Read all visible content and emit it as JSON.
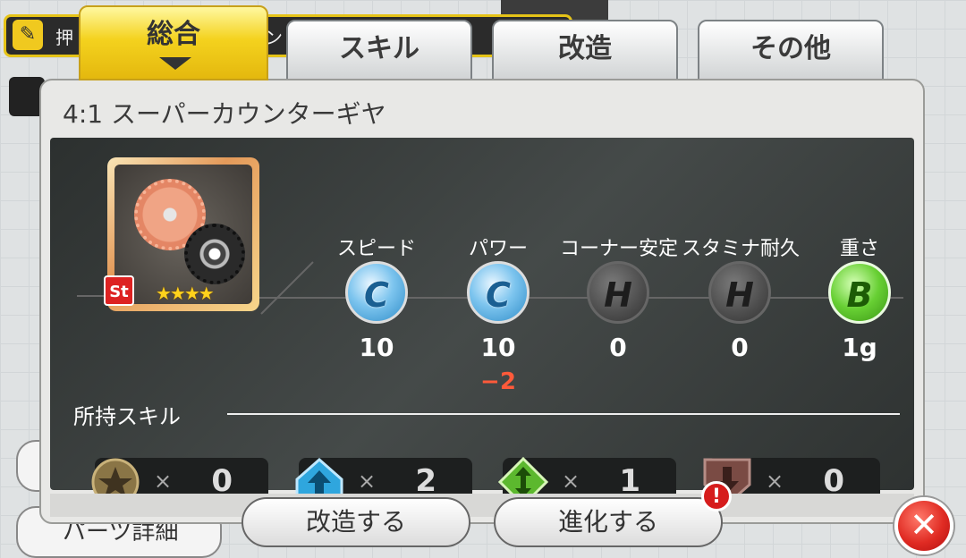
{
  "background": {
    "top_bar_label": "押",
    "top_bar_label_tail": "ン",
    "left_button_label": "パーツ詳細"
  },
  "tabs": [
    {
      "label": "総合",
      "active": true
    },
    {
      "label": "スキル",
      "active": false
    },
    {
      "label": "改造",
      "active": false
    },
    {
      "label": "その他",
      "active": false
    }
  ],
  "panel": {
    "title": "4:1 スーパーカウンターギヤ",
    "part": {
      "badge": "St",
      "stars": "★★★★",
      "star_count": 4
    },
    "stats": [
      {
        "label": "スピード",
        "grade": "C",
        "value": "10",
        "delta": ""
      },
      {
        "label": "パワー",
        "grade": "C",
        "value": "10",
        "delta": "−2"
      },
      {
        "label": "コーナー安定",
        "grade": "H",
        "value": "0",
        "delta": ""
      },
      {
        "label": "スタミナ耐久",
        "grade": "H",
        "value": "0",
        "delta": ""
      },
      {
        "label": "重さ",
        "grade": "B",
        "value": "1g",
        "delta": ""
      }
    ],
    "skills_heading": "所持スキル",
    "skills": [
      {
        "icon": "star-icon",
        "x": "×",
        "count": "0"
      },
      {
        "icon": "up-arrow-icon",
        "x": "×",
        "count": "2"
      },
      {
        "icon": "up-down-arrow-icon",
        "x": "×",
        "count": "1"
      },
      {
        "icon": "down-arrow-icon",
        "x": "×",
        "count": "0"
      }
    ]
  },
  "buttons": {
    "modify": "改造する",
    "evolve": "進化する",
    "alert": "!",
    "close": "✕"
  },
  "colors": {
    "tab_active": "#f4d21e",
    "grade_c": "#7cc4ee",
    "grade_h": "#4d4d4d",
    "grade_b": "#67cf33",
    "close": "#e02b23"
  }
}
